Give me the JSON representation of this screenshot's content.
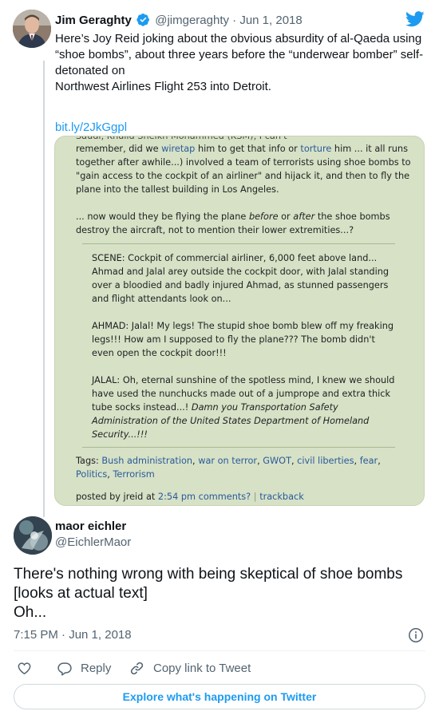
{
  "colors": {
    "accent": "#1d9bf0",
    "text": "#0f1419",
    "muted": "#536471",
    "border": "#cfd9de",
    "embed_bg": "#d6e1c6",
    "embed_link": "#2b5a9a"
  },
  "icons": {
    "logo": "twitter-bird-icon",
    "verified": "verified-badge-icon",
    "info": "info-icon",
    "like": "heart-icon",
    "reply": "reply-bubble-icon",
    "copy": "link-chain-icon"
  },
  "quoted_tweet": {
    "name": "Jim Geraghty",
    "handle": "@jimgeraghty",
    "separator": "·",
    "date": "Jun 1, 2018",
    "text_lines": [
      "Here’s Joy Reid joking about the obvious absurdity of al-Qaeda using",
      "“shoe bombs”, about three years before the “underwear bomber” self-",
      "detonated on",
      "Northwest Airlines Flight 253 into Detroit."
    ],
    "link": "bit.ly/2JkGgpl",
    "embedded_post": {
      "lines": {
        "l1a": "remember, did we ",
        "l1b": "wiretap",
        "l1c": " him to get that info or ",
        "l1d": "torture",
        "l1e": " him ... it all runs",
        "l2": "together after awhile...) involved a team of terrorists using shoe bombs to",
        "l3": "\"gain access to the cockpit of an airliner\" and hijack it, and then to fly the",
        "l4": "plane into the tallest building in Los Angeles.",
        "l5a": "... now would they be flying the plane ",
        "l5b": "before",
        "l5c": " or ",
        "l5d": "after",
        "l5e": " the shoe bombs",
        "l6": "destroy the aircraft, not to mention their lower extremities...?",
        "s1": "SCENE: Cockpit of commercial airliner, 6,000 feet above land...",
        "s2": "Ahmad and Jalal arey outside the cockpit door, with Jalal standing",
        "s3": "over a bloodied and badly injured Ahmad, as stunned passengers",
        "s4": "and flight attendants look on...",
        "a1": "AHMAD: Jalal! My legs! The stupid shoe bomb blew off my freaking",
        "a2": "legs!!! How am I supposed to fly the plane??? The bomb didn't",
        "a3": "even open the cockpit door!!!",
        "j1": "JALAL: Oh, eternal sunshine of the spotless mind, I knew we should",
        "j2": "have used the nunchucks made out of a jumprope and extra thick",
        "j3a": "tube socks instead...! ",
        "j3b": "Damn you Transportation Safety",
        "j4": "Administration of the United States Department of Homeland",
        "j5": "Security...!!!"
      },
      "tags_label": "Tags: ",
      "tags": [
        "Bush administration",
        "war on terror",
        "GWOT",
        "civil liberties",
        "fear",
        "Politics",
        "Terrorism"
      ],
      "posted_by": "posted by jreid at ",
      "post_time": "2:54 pm",
      "comments": "comments?",
      "trackback": "trackback",
      "pipe": "|"
    }
  },
  "main_tweet": {
    "name": "maor eichler",
    "handle": "@EichlerMaor",
    "text_lines": [
      "There's nothing wrong with being skeptical of shoe bombs",
      "[looks at actual text]",
      "Oh..."
    ],
    "timestamp": "7:15 PM · Jun 1, 2018"
  },
  "actions": {
    "reply_label": "Reply",
    "copy_label": "Copy link to Tweet"
  },
  "explore_label": "Explore what's happening on Twitter"
}
